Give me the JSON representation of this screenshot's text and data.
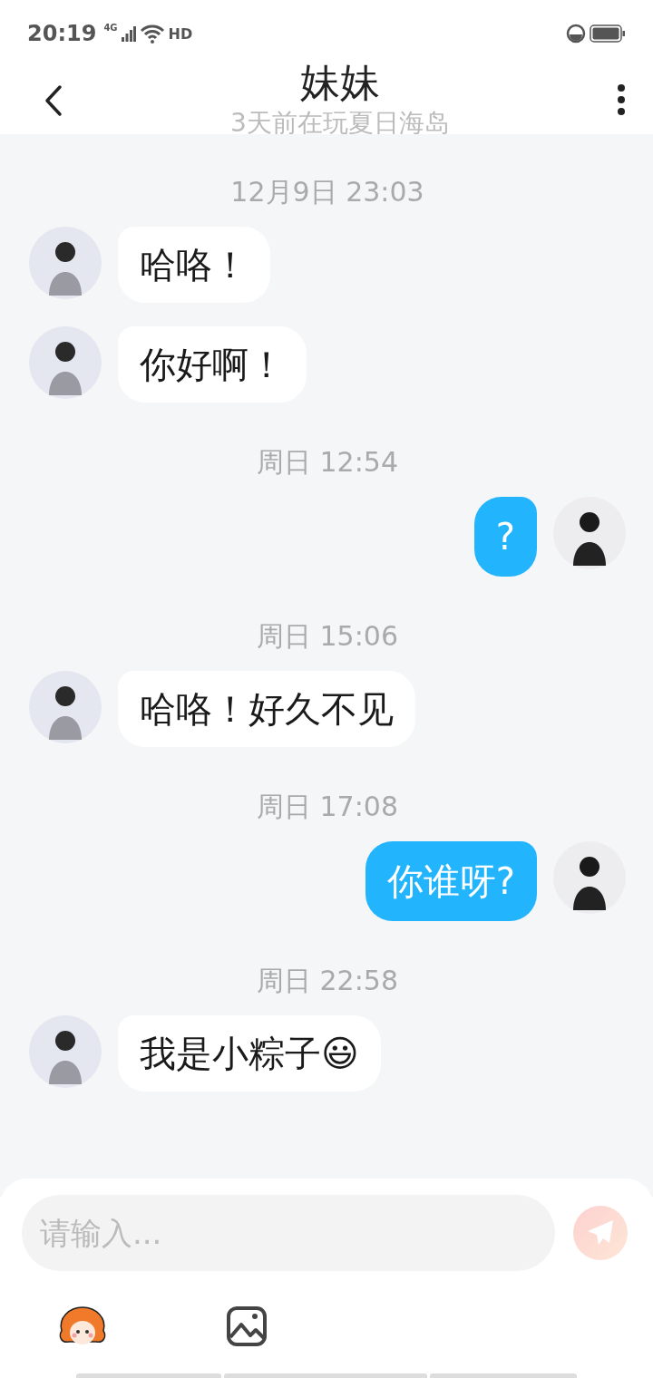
{
  "status_bar": {
    "time": "20:19",
    "network": "4G",
    "hd": "HD"
  },
  "header": {
    "title": "妹妹",
    "subtitle": "3天前在玩夏日海岛"
  },
  "messages": [
    {
      "kind": "time",
      "text": "12月9日 23:03"
    },
    {
      "kind": "message",
      "outgoing": false,
      "text": "哈咯！"
    },
    {
      "kind": "message",
      "outgoing": false,
      "text": "你好啊！"
    },
    {
      "kind": "time",
      "text": "周日 12:54"
    },
    {
      "kind": "message",
      "outgoing": true,
      "text": "?"
    },
    {
      "kind": "time",
      "text": "周日 15:06"
    },
    {
      "kind": "message",
      "outgoing": false,
      "text": "哈咯！好久不见"
    },
    {
      "kind": "time",
      "text": "周日 17:08"
    },
    {
      "kind": "message",
      "outgoing": true,
      "text": "你谁呀?"
    },
    {
      "kind": "time",
      "text": "周日 22:58"
    },
    {
      "kind": "message",
      "outgoing": false,
      "text": "我是小粽子😃"
    }
  ],
  "composer": {
    "placeholder": "请输入..."
  }
}
